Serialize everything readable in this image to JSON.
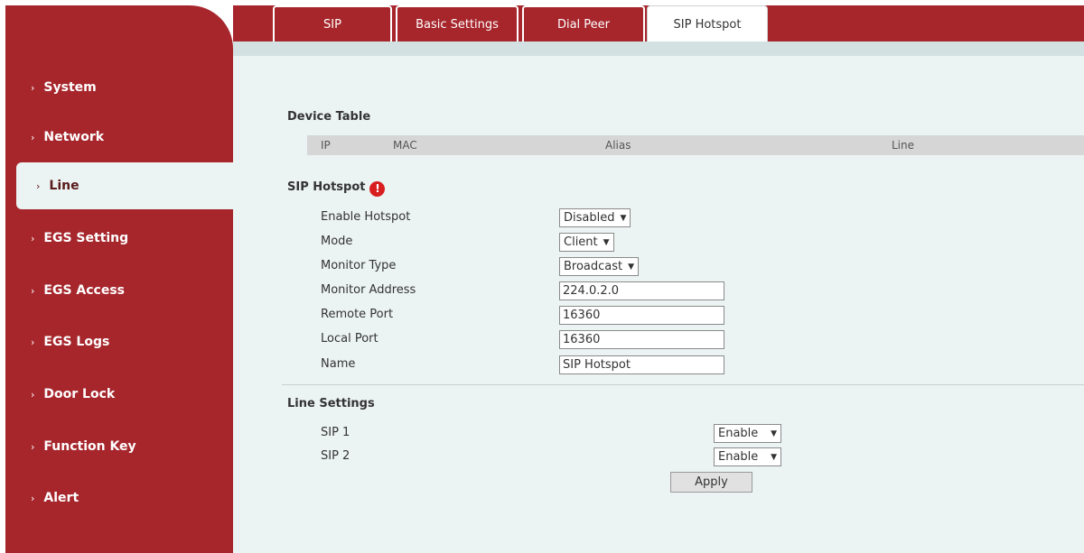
{
  "sidebar": {
    "items": [
      {
        "label": "System"
      },
      {
        "label": "Network"
      },
      {
        "label": "Line"
      },
      {
        "label": "EGS Setting"
      },
      {
        "label": "EGS Access"
      },
      {
        "label": "EGS Logs"
      },
      {
        "label": "Door Lock"
      },
      {
        "label": "Function Key"
      },
      {
        "label": "Alert"
      }
    ],
    "active": "Line",
    "chevron": "›"
  },
  "tabs": [
    {
      "label": "SIP"
    },
    {
      "label": "Basic Settings"
    },
    {
      "label": "Dial Peer"
    },
    {
      "label": "SIP Hotspot"
    }
  ],
  "device_table": {
    "title": "Device Table",
    "columns": [
      "IP",
      "MAC",
      "Alias",
      "Line"
    ]
  },
  "sip_hotspot": {
    "title": "SIP Hotspot",
    "info_icon_glyph": "!",
    "enable_hotspot": {
      "label": "Enable Hotspot",
      "value": "Disabled"
    },
    "mode": {
      "label": "Mode",
      "value": "Client"
    },
    "monitor_type": {
      "label": "Monitor Type",
      "value": "Broadcast"
    },
    "monitor_address": {
      "label": "Monitor Address",
      "value": "224.0.2.0"
    },
    "remote_port": {
      "label": "Remote Port",
      "value": "16360"
    },
    "local_port": {
      "label": "Local Port",
      "value": "16360"
    },
    "name": {
      "label": "Name",
      "value": "SIP Hotspot"
    }
  },
  "line_settings": {
    "title": "Line Settings",
    "sip1": {
      "label": "SIP 1",
      "value": "Enable"
    },
    "sip2": {
      "label": "SIP 2",
      "value": "Enable"
    }
  },
  "apply_label": "Apply",
  "dropdown_arrow": "▼",
  "colors": {
    "brand_red": "#a6262c",
    "content_bg": "#ecf3f3",
    "info_red": "#d81e1e"
  }
}
